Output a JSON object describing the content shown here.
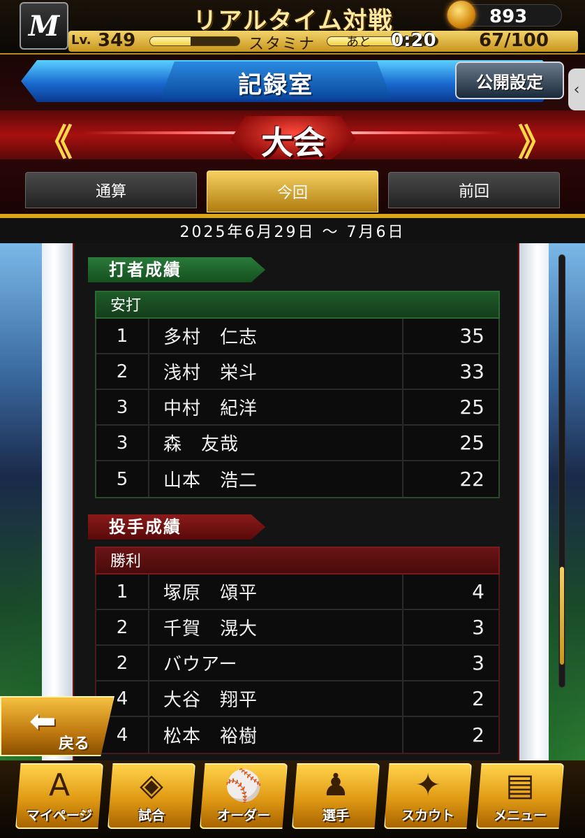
{
  "header": {
    "team_logo": "M",
    "mode_title": "リアルタイム対戦",
    "coins": "893",
    "level_label": "Lv.",
    "level": "349",
    "exp_fraction": 0.45,
    "stamina_label": "スタミナ",
    "stamina_fraction": 0.67,
    "recover_label": "あと",
    "recover_time": "0:20",
    "stamina_value": "67/100"
  },
  "title_bar": {
    "title": "記録室",
    "public_button": "公開設定"
  },
  "category": {
    "label": "大会",
    "prev_arrow": "《",
    "next_arrow": "》"
  },
  "tabs": [
    {
      "label": "通算",
      "active": false
    },
    {
      "label": "今回",
      "active": true
    },
    {
      "label": "前回",
      "active": false
    }
  ],
  "period": "2025年6月29日 〜 7月6日",
  "batting": {
    "section_title": "打者成績",
    "caption": "安打",
    "rows": [
      {
        "rank": "1",
        "name": "多村　仁志",
        "value": "35"
      },
      {
        "rank": "2",
        "name": "浅村　栄斗",
        "value": "33"
      },
      {
        "rank": "3",
        "name": "中村　紀洋",
        "value": "25"
      },
      {
        "rank": "3",
        "name": "森　友哉",
        "value": "25"
      },
      {
        "rank": "5",
        "name": "山本　浩二",
        "value": "22"
      }
    ]
  },
  "pitching": {
    "section_title": "投手成績",
    "caption": "勝利",
    "rows": [
      {
        "rank": "1",
        "name": "塚原　頌平",
        "value": "4"
      },
      {
        "rank": "2",
        "name": "千賀　滉大",
        "value": "3"
      },
      {
        "rank": "2",
        "name": "バウアー",
        "value": "3"
      },
      {
        "rank": "4",
        "name": "大谷　翔平",
        "value": "2"
      },
      {
        "rank": "4",
        "name": "松本　裕樹",
        "value": "2"
      }
    ]
  },
  "back_button": "戻る",
  "bottom_nav": [
    {
      "label": "マイページ",
      "icon": "A"
    },
    {
      "label": "試合",
      "icon": "◈"
    },
    {
      "label": "オーダー",
      "icon": "⚾"
    },
    {
      "label": "選手",
      "icon": "♟"
    },
    {
      "label": "スカウト",
      "icon": "✦"
    },
    {
      "label": "メニュー",
      "icon": "▤"
    }
  ]
}
